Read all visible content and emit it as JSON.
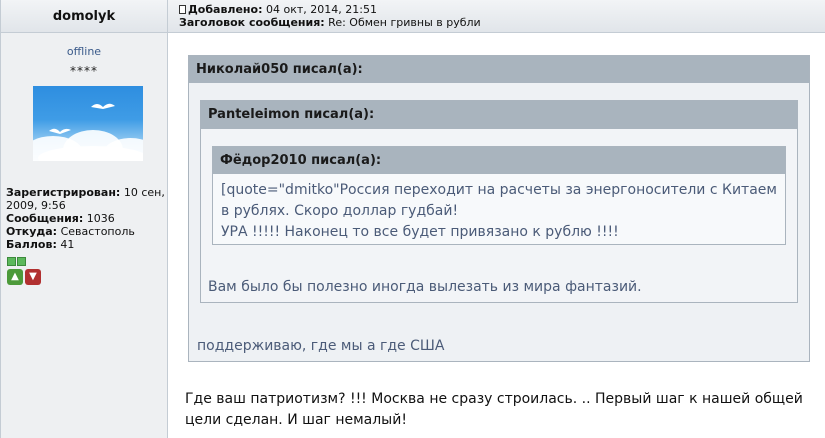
{
  "author": {
    "username": "domolyk",
    "status": "offline",
    "rank_stars": "****",
    "registered_label": "Зарегистрирован:",
    "registered_value": " 10 сен, 2009, 9:56",
    "posts_label": "Сообщения:",
    "posts_value": " 1036",
    "location_label": "Откуда:",
    "location_value": " Севастополь",
    "points_label": "Баллов:",
    "points_value": " 41"
  },
  "post": {
    "added_label": "Добавлено:",
    "added_value": " 04 окт, 2014, 21:51",
    "subject_label": "Заголовок сообщения:",
    "subject_value": " Re: Обмен гривны в рубли",
    "quote1": {
      "header": "Николай050 писал(а):",
      "text": "поддерживаю, где мы а где США"
    },
    "quote2": {
      "header": "Panteleimon писал(а):",
      "text": "Вам было бы полезно иногда вылезать из мира фантазий."
    },
    "quote3": {
      "header": "Фёдор2010 писал(а):",
      "line1": "[quote=\"dmitko\"Россия переходит на расчеты за энергоносители с Китаем",
      "line2": "в рублях. Скоро доллар гудбай!",
      "line3": "УРА !!!!! Наконец то все будет привязано к рублю !!!!"
    },
    "body_line1": "Где ваш патриотизм? !!! Москва не сразу строилась. .. Первый шаг к нашей общей",
    "body_line2": "цели сделан. И шаг немалый!"
  },
  "colors": {
    "quote_header": "#a9b4be",
    "quote_text": "#4b5b78",
    "reputation_good": "#5cb85c",
    "vote_up": "#4c9a3a",
    "vote_down": "#b13030"
  },
  "icons": [
    "post-document-icon",
    "thumbs-up-icon",
    "thumbs-down-icon",
    "reputation-icon"
  ]
}
